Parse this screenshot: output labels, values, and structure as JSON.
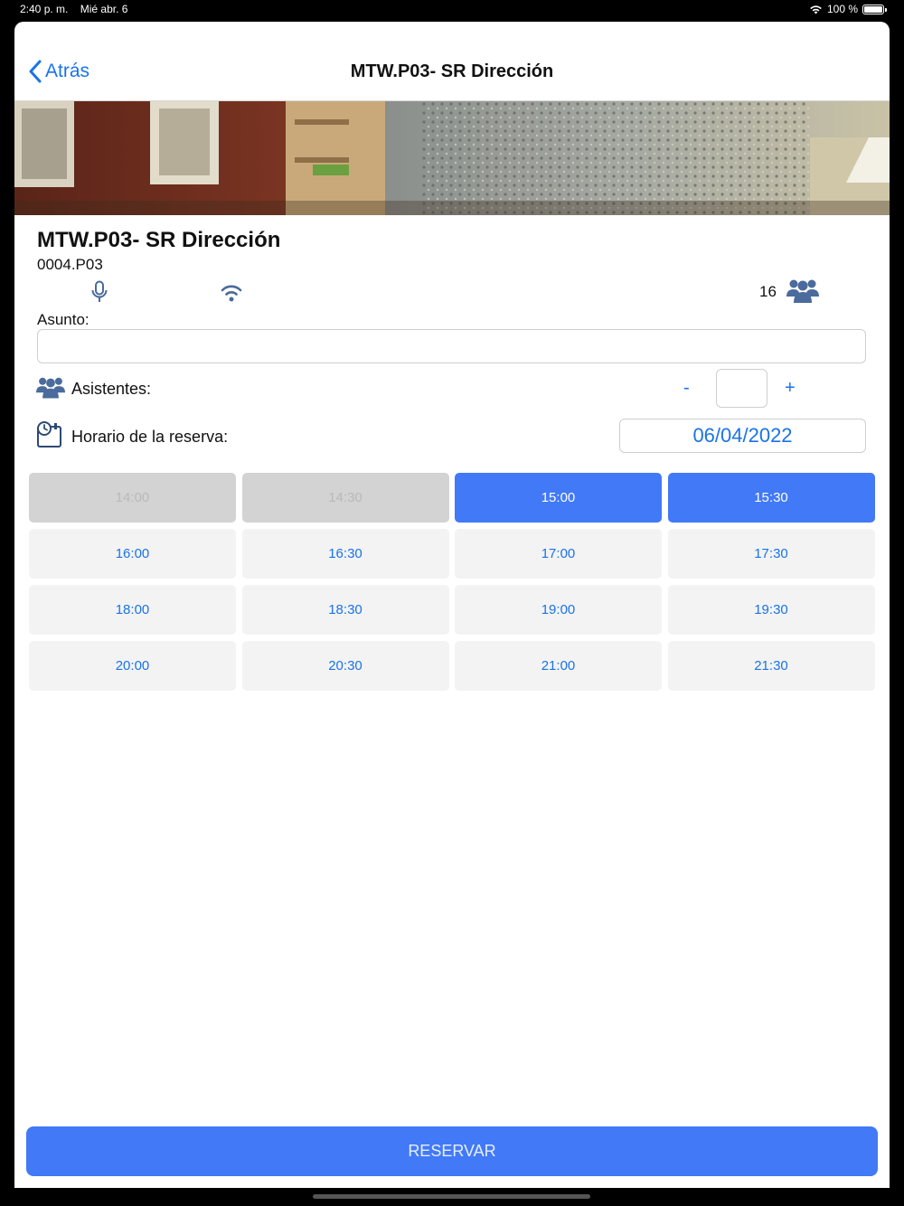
{
  "status_bar": {
    "time": "2:40 p. m.",
    "date": "Mié abr. 6",
    "battery": "100 %",
    "battery_level": 1.0
  },
  "navbar": {
    "back_label": "Atrás",
    "title": "MTW.P03- SR Dirección"
  },
  "room": {
    "name": "MTW.P03- SR Dirección",
    "code": "0004.P03",
    "features": [
      "microphone-icon",
      "wifi-icon"
    ],
    "capacity": "16"
  },
  "form": {
    "asunto_label": "Asunto:",
    "asunto_value": "",
    "asistentes_label": "Asistentes:",
    "minus_label": "-",
    "plus_label": "+",
    "asistentes_value": "",
    "horario_label": "Horario de la reserva:",
    "date": "06/04/2022"
  },
  "slots": [
    {
      "time": "14:00",
      "state": "disabled"
    },
    {
      "time": "14:30",
      "state": "disabled"
    },
    {
      "time": "15:00",
      "state": "selected"
    },
    {
      "time": "15:30",
      "state": "selected"
    },
    {
      "time": "16:00",
      "state": "available"
    },
    {
      "time": "16:30",
      "state": "available"
    },
    {
      "time": "17:00",
      "state": "available"
    },
    {
      "time": "17:30",
      "state": "available"
    },
    {
      "time": "18:00",
      "state": "available"
    },
    {
      "time": "18:30",
      "state": "available"
    },
    {
      "time": "19:00",
      "state": "available"
    },
    {
      "time": "19:30",
      "state": "available"
    },
    {
      "time": "20:00",
      "state": "available"
    },
    {
      "time": "20:30",
      "state": "available"
    },
    {
      "time": "21:00",
      "state": "available"
    },
    {
      "time": "21:30",
      "state": "available"
    }
  ],
  "reserve_button": "RESERVAR",
  "colors": {
    "accent": "#1a73e8",
    "selected_slot": "#4179f7",
    "disabled_slot": "#d3d3d3",
    "icon_blue": "#4a6b9c"
  }
}
